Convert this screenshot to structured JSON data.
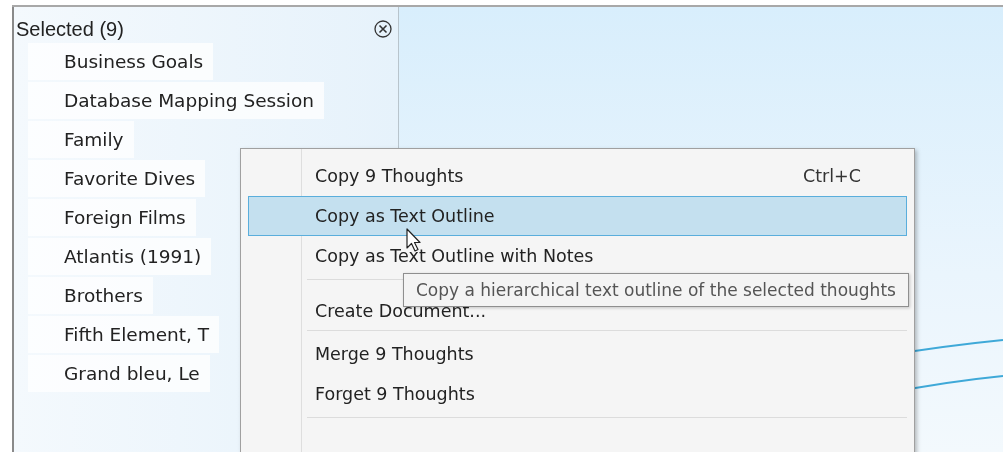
{
  "selection_panel": {
    "title": "Selected (9)",
    "items": [
      {
        "label": "Business Goals"
      },
      {
        "label": "Database Mapping Session"
      },
      {
        "label": "Family"
      },
      {
        "label": "Favorite Dives"
      },
      {
        "label": "Foreign Films"
      },
      {
        "label": "Atlantis (1991)"
      },
      {
        "label": "Brothers"
      },
      {
        "label": "Fifth Element, T"
      },
      {
        "label": "Grand bleu, Le"
      }
    ]
  },
  "context_menu": {
    "items": [
      {
        "kind": "command",
        "label": "Copy 9 Thoughts",
        "shortcut": "Ctrl+C",
        "selected": false
      },
      {
        "kind": "command",
        "label": "Copy as Text Outline",
        "selected": true
      },
      {
        "kind": "command",
        "label": "Copy as Text Outline with Notes",
        "selected": false
      },
      {
        "kind": "separator"
      },
      {
        "kind": "command",
        "label": "Create Document...",
        "selected": false
      },
      {
        "kind": "separator"
      },
      {
        "kind": "command",
        "label": "Merge 9 Thoughts",
        "selected": false
      },
      {
        "kind": "command",
        "label": "Forget 9 Thoughts",
        "selected": false
      },
      {
        "kind": "separator"
      }
    ]
  },
  "tooltip": {
    "text": "Copy a hierarchical text outline of the selected thoughts"
  }
}
